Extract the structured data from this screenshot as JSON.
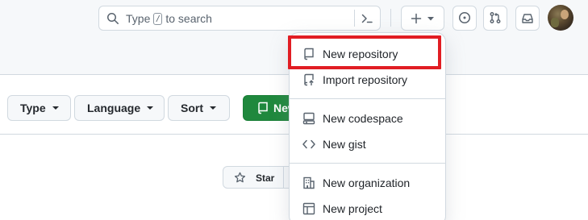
{
  "header": {
    "search": {
      "placeholder_before": "Type",
      "shortcut_key": "/",
      "placeholder_after": "to search"
    },
    "icons": {
      "search": "search-icon",
      "command_palette": "terminal-icon",
      "create_new": "plus-icon",
      "issues": "issue-opened-icon",
      "pull_requests": "git-pull-request-icon",
      "inbox": "inbox-icon",
      "avatar": "user-avatar"
    }
  },
  "filters": {
    "type_label": "Type",
    "language_label": "Language",
    "sort_label": "Sort",
    "new_label": "New"
  },
  "repo_card": {
    "star_label": "Star"
  },
  "create_menu": {
    "items": [
      {
        "label": "New repository",
        "icon": "repo-icon"
      },
      {
        "label": "Import repository",
        "icon": "repo-push-icon"
      },
      {
        "label": "New codespace",
        "icon": "codespaces-icon"
      },
      {
        "label": "New gist",
        "icon": "code-icon"
      },
      {
        "label": "New organization",
        "icon": "organization-icon"
      },
      {
        "label": "New project",
        "icon": "table-icon"
      }
    ]
  },
  "colors": {
    "primary_button": "#1f883d",
    "highlight_box": "#e11d23",
    "header_bg": "#f6f8fa",
    "border": "#d1d9e0"
  }
}
